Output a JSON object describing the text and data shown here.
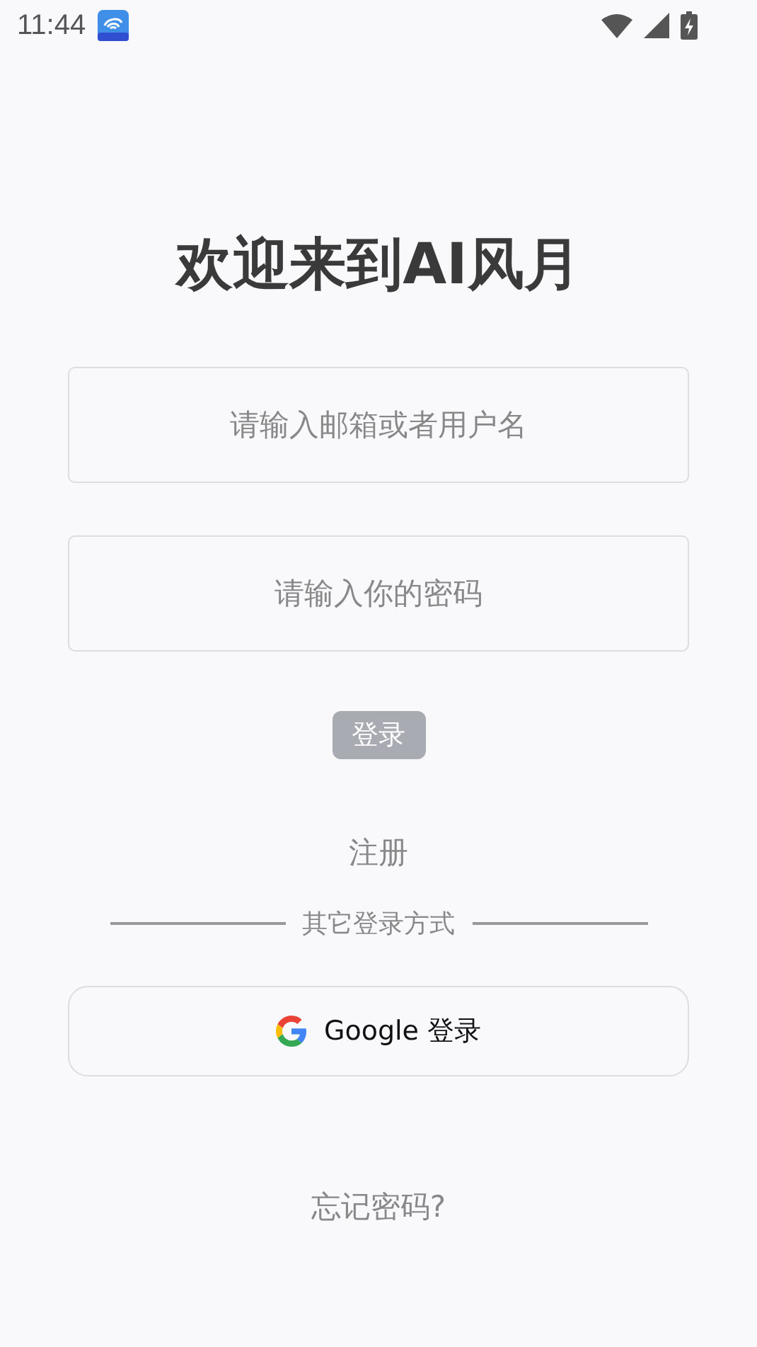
{
  "status_bar": {
    "time": "11:44"
  },
  "title": "欢迎来到AI风月",
  "fields": [
    {
      "placeholder": "请输入邮箱或者用户名"
    },
    {
      "placeholder": "请输入你的密码"
    }
  ],
  "login_button": {
    "label": "登录",
    "disabled": true
  },
  "register_link": "注册",
  "divider_text": "其它登录方式",
  "google_button": {
    "label": "Google 登录"
  },
  "forgot_link": "忘记密码?"
}
